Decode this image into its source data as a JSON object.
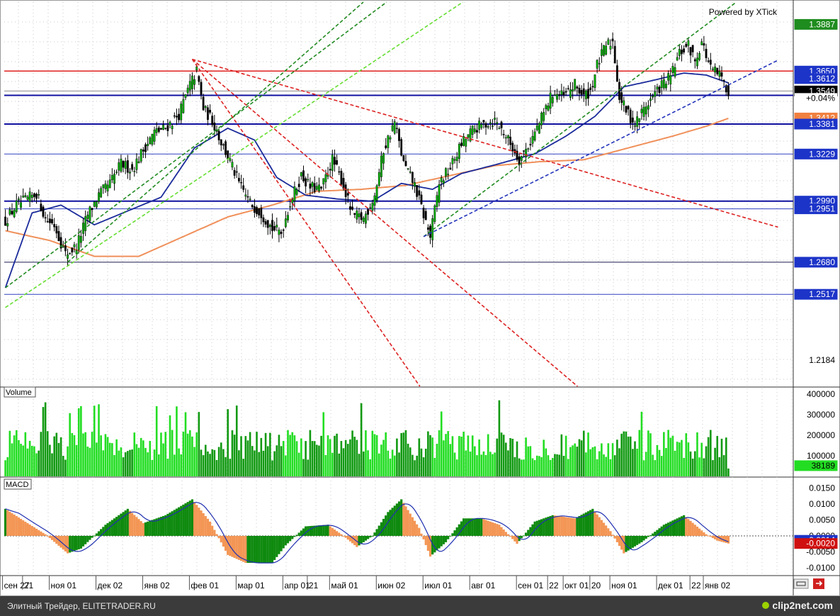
{
  "powered_by": "Powered by XTick",
  "footer": {
    "caption": "Элитный Трейдер, ELITETRADER.RU",
    "brand": "clip2net.com"
  },
  "price_pane": {
    "y_range": [
      1.205,
      1.4
    ],
    "price_labels": [
      {
        "text": "1.3887",
        "value": 1.3887,
        "bg": "#1e8c1e",
        "fg": "#ffffff"
      },
      {
        "text": "1.3650",
        "value": 1.365,
        "bg": "#1c34c8",
        "fg": "#ffffff"
      },
      {
        "text": "1.3612",
        "value": 1.3612,
        "bg": "#1c34c8",
        "fg": "#ffffff"
      },
      {
        "text": "1.3549",
        "value": 1.3549,
        "bg": "#000000",
        "fg": "#ffffff"
      },
      {
        "text": "+0.04%",
        "value": 1.3513,
        "bg": "#ffffff",
        "fg": "#000000"
      },
      {
        "text": "1.3412",
        "value": 1.3412,
        "bg": "#f08040",
        "fg": "#ffffff"
      },
      {
        "text": "1.3381",
        "value": 1.3381,
        "bg": "#1c34c8",
        "fg": "#ffffff"
      },
      {
        "text": "1.3229",
        "value": 1.3229,
        "bg": "#1c34c8",
        "fg": "#ffffff"
      },
      {
        "text": "1.2990",
        "value": 1.299,
        "bg": "#1c34c8",
        "fg": "#ffffff"
      },
      {
        "text": "1.2951",
        "value": 1.2951,
        "bg": "#1c34c8",
        "fg": "#ffffff"
      },
      {
        "text": "1.2680",
        "value": 1.268,
        "bg": "#1c34c8",
        "fg": "#ffffff"
      },
      {
        "text": "1.2517",
        "value": 1.2517,
        "bg": "#1c34c8",
        "fg": "#ffffff"
      },
      {
        "text": "1.2184",
        "value": 1.2184,
        "bg": "#ffffff",
        "fg": "#000000"
      }
    ],
    "horizontal_levels": [
      {
        "value": 1.365,
        "color": "#e02020",
        "width": 1.5
      },
      {
        "value": 1.3549,
        "color": "#888888",
        "width": 1
      },
      {
        "value": 1.3527,
        "color": "#1010a0",
        "width": 2
      },
      {
        "value": 1.3381,
        "color": "#1010a0",
        "width": 2
      },
      {
        "value": 1.3229,
        "color": "#3040c0",
        "width": 1
      },
      {
        "value": 1.299,
        "color": "#1010a0",
        "width": 2
      },
      {
        "value": 1.2951,
        "color": "#3040c0",
        "width": 1
      },
      {
        "value": 1.268,
        "color": "#1a1a50",
        "width": 1
      },
      {
        "value": 1.2517,
        "color": "#3040c0",
        "width": 1
      }
    ]
  },
  "volume_pane": {
    "label": "Volume",
    "y_range": [
      0,
      400000
    ],
    "ticks": [
      {
        "text": "400000",
        "value": 400000
      },
      {
        "text": "300000",
        "value": 300000
      },
      {
        "text": "200000",
        "value": 200000
      },
      {
        "text": "100000",
        "value": 100000
      }
    ],
    "last_label": {
      "text": "38189",
      "value": 38189,
      "bg": "#22dd22",
      "fg": "#000000"
    }
  },
  "macd_pane": {
    "label": "MACD",
    "y_range": [
      -0.0125,
      0.0185
    ],
    "ticks": [
      {
        "text": "0.0150",
        "value": 0.015
      },
      {
        "text": "0.0100",
        "value": 0.01
      },
      {
        "text": "0.0050",
        "value": 0.005
      },
      {
        "text": "0.0000",
        "value": 0.0
      },
      {
        "text": "-0.0050",
        "value": -0.005
      },
      {
        "text": "-0.0100",
        "value": -0.01
      }
    ],
    "last_labels": [
      {
        "text": "-0.0014",
        "value": -0.0014,
        "bg": "#1c34c8",
        "fg": "#ffffff"
      },
      {
        "text": "-0.0020",
        "value": -0.0024,
        "bg": "#d01010",
        "fg": "#ffffff"
      }
    ]
  },
  "x_axis": {
    "labels": [
      {
        "text": "сен 27",
        "bar": 0
      },
      {
        "text": "21",
        "bar": 9
      },
      {
        "text": "ноя 01",
        "bar": 21
      },
      {
        "text": "дек 02",
        "bar": 42
      },
      {
        "text": "янв 02",
        "bar": 63
      },
      {
        "text": "фев 01",
        "bar": 84
      },
      {
        "text": "мар 01",
        "bar": 105
      },
      {
        "text": "апр 01",
        "bar": 126
      },
      {
        "text": "21",
        "bar": 137
      },
      {
        "text": "май 01",
        "bar": 147
      },
      {
        "text": "июн 02",
        "bar": 168
      },
      {
        "text": "июл 01",
        "bar": 189
      },
      {
        "text": "авг 01",
        "bar": 210
      },
      {
        "text": "сен 01",
        "bar": 231
      },
      {
        "text": "22",
        "bar": 245
      },
      {
        "text": "окт 01",
        "bar": 252
      },
      {
        "text": "20",
        "bar": 264
      },
      {
        "text": "ноя 01",
        "bar": 273
      },
      {
        "text": "дек 01",
        "bar": 294
      },
      {
        "text": "22",
        "bar": 309
      },
      {
        "text": "янв 02",
        "bar": 315
      }
    ]
  },
  "chart_data": {
    "type": "candlestick",
    "series_count_bars": 326,
    "anchors": [
      {
        "bar": 0,
        "price": 1.289
      },
      {
        "bar": 5,
        "price": 1.297
      },
      {
        "bar": 10,
        "price": 1.3
      },
      {
        "bar": 14,
        "price": 1.303
      },
      {
        "bar": 18,
        "price": 1.29
      },
      {
        "bar": 22,
        "price": 1.287
      },
      {
        "bar": 27,
        "price": 1.272
      },
      {
        "bar": 32,
        "price": 1.276
      },
      {
        "bar": 37,
        "price": 1.292
      },
      {
        "bar": 42,
        "price": 1.302
      },
      {
        "bar": 47,
        "price": 1.308
      },
      {
        "bar": 52,
        "price": 1.318
      },
      {
        "bar": 57,
        "price": 1.315
      },
      {
        "bar": 62,
        "price": 1.325
      },
      {
        "bar": 67,
        "price": 1.334
      },
      {
        "bar": 72,
        "price": 1.336
      },
      {
        "bar": 78,
        "price": 1.343
      },
      {
        "bar": 83,
        "price": 1.358
      },
      {
        "bar": 86,
        "price": 1.365
      },
      {
        "bar": 89,
        "price": 1.346
      },
      {
        "bar": 93,
        "price": 1.34
      },
      {
        "bar": 97,
        "price": 1.329
      },
      {
        "bar": 101,
        "price": 1.319
      },
      {
        "bar": 105,
        "price": 1.308
      },
      {
        "bar": 110,
        "price": 1.298
      },
      {
        "bar": 115,
        "price": 1.293
      },
      {
        "bar": 120,
        "price": 1.285
      },
      {
        "bar": 124,
        "price": 1.283
      },
      {
        "bar": 128,
        "price": 1.298
      },
      {
        "bar": 133,
        "price": 1.312
      },
      {
        "bar": 137,
        "price": 1.306
      },
      {
        "bar": 142,
        "price": 1.305
      },
      {
        "bar": 147,
        "price": 1.32
      },
      {
        "bar": 151,
        "price": 1.31
      },
      {
        "bar": 156,
        "price": 1.292
      },
      {
        "bar": 161,
        "price": 1.29
      },
      {
        "bar": 166,
        "price": 1.302
      },
      {
        "bar": 170,
        "price": 1.325
      },
      {
        "bar": 175,
        "price": 1.339
      },
      {
        "bar": 179,
        "price": 1.318
      },
      {
        "bar": 184,
        "price": 1.307
      },
      {
        "bar": 188,
        "price": 1.292
      },
      {
        "bar": 191,
        "price": 1.281
      },
      {
        "bar": 195,
        "price": 1.308
      },
      {
        "bar": 200,
        "price": 1.316
      },
      {
        "bar": 205,
        "price": 1.328
      },
      {
        "bar": 210,
        "price": 1.335
      },
      {
        "bar": 215,
        "price": 1.338
      },
      {
        "bar": 220,
        "price": 1.34
      },
      {
        "bar": 224,
        "price": 1.334
      },
      {
        "bar": 228,
        "price": 1.326
      },
      {
        "bar": 231,
        "price": 1.32
      },
      {
        "bar": 236,
        "price": 1.329
      },
      {
        "bar": 241,
        "price": 1.341
      },
      {
        "bar": 246,
        "price": 1.354
      },
      {
        "bar": 251,
        "price": 1.352
      },
      {
        "bar": 256,
        "price": 1.358
      },
      {
        "bar": 260,
        "price": 1.352
      },
      {
        "bar": 263,
        "price": 1.355
      },
      {
        "bar": 266,
        "price": 1.368
      },
      {
        "bar": 270,
        "price": 1.378
      },
      {
        "bar": 273,
        "price": 1.38
      },
      {
        "bar": 276,
        "price": 1.352
      },
      {
        "bar": 279,
        "price": 1.345
      },
      {
        "bar": 283,
        "price": 1.338
      },
      {
        "bar": 287,
        "price": 1.346
      },
      {
        "bar": 291,
        "price": 1.352
      },
      {
        "bar": 295,
        "price": 1.358
      },
      {
        "bar": 299,
        "price": 1.362
      },
      {
        "bar": 303,
        "price": 1.374
      },
      {
        "bar": 307,
        "price": 1.378
      },
      {
        "bar": 310,
        "price": 1.37
      },
      {
        "bar": 313,
        "price": 1.38
      },
      {
        "bar": 317,
        "price": 1.366
      },
      {
        "bar": 321,
        "price": 1.363
      },
      {
        "bar": 325,
        "price": 1.3549
      }
    ],
    "sma_blue_anchors": [
      {
        "bar": 0,
        "price": 1.255
      },
      {
        "bar": 12,
        "price": 1.293
      },
      {
        "bar": 25,
        "price": 1.297
      },
      {
        "bar": 40,
        "price": 1.287
      },
      {
        "bar": 55,
        "price": 1.294
      },
      {
        "bar": 70,
        "price": 1.301
      },
      {
        "bar": 85,
        "price": 1.326
      },
      {
        "bar": 100,
        "price": 1.336
      },
      {
        "bar": 112,
        "price": 1.33
      },
      {
        "bar": 122,
        "price": 1.311
      },
      {
        "bar": 135,
        "price": 1.302
      },
      {
        "bar": 150,
        "price": 1.3
      },
      {
        "bar": 165,
        "price": 1.299
      },
      {
        "bar": 178,
        "price": 1.308
      },
      {
        "bar": 192,
        "price": 1.305
      },
      {
        "bar": 205,
        "price": 1.313
      },
      {
        "bar": 222,
        "price": 1.318
      },
      {
        "bar": 238,
        "price": 1.323
      },
      {
        "bar": 252,
        "price": 1.332
      },
      {
        "bar": 265,
        "price": 1.342
      },
      {
        "bar": 278,
        "price": 1.357
      },
      {
        "bar": 290,
        "price": 1.36
      },
      {
        "bar": 305,
        "price": 1.364
      },
      {
        "bar": 315,
        "price": 1.363
      },
      {
        "bar": 325,
        "price": 1.359
      }
    ],
    "sma_orange_anchors": [
      {
        "bar": 0,
        "price": 1.284
      },
      {
        "bar": 20,
        "price": 1.279
      },
      {
        "bar": 40,
        "price": 1.271
      },
      {
        "bar": 60,
        "price": 1.271
      },
      {
        "bar": 80,
        "price": 1.281
      },
      {
        "bar": 100,
        "price": 1.291
      },
      {
        "bar": 120,
        "price": 1.297
      },
      {
        "bar": 140,
        "price": 1.304
      },
      {
        "bar": 160,
        "price": 1.305
      },
      {
        "bar": 180,
        "price": 1.307
      },
      {
        "bar": 200,
        "price": 1.312
      },
      {
        "bar": 220,
        "price": 1.317
      },
      {
        "bar": 240,
        "price": 1.319
      },
      {
        "bar": 260,
        "price": 1.32
      },
      {
        "bar": 280,
        "price": 1.326
      },
      {
        "bar": 300,
        "price": 1.332
      },
      {
        "bar": 315,
        "price": 1.337
      },
      {
        "bar": 325,
        "price": 1.341
      }
    ],
    "trendlines": [
      {
        "color": "#228b22",
        "p1": {
          "bar": 0,
          "price": 1.255
        },
        "p2": {
          "bar": 325,
          "price": 1.53
        }
      },
      {
        "color": "#228b22",
        "p1": {
          "bar": 28,
          "price": 1.268
        },
        "p2": {
          "bar": 325,
          "price": 1.563
        }
      },
      {
        "color": "#66dd33",
        "p1": {
          "bar": 0,
          "price": 1.245
        },
        "p2": {
          "bar": 325,
          "price": 1.49
        }
      },
      {
        "color": "#228b22",
        "p1": {
          "bar": 188,
          "price": 1.281
        },
        "p2": {
          "bar": 325,
          "price": 1.397
        }
      },
      {
        "color": "#2233bb",
        "p1": {
          "bar": 188,
          "price": 1.281
        },
        "p2": {
          "bar": 325,
          "price": 1.358
        }
      },
      {
        "color": "#dd2222",
        "p1": {
          "bar": 84,
          "price": 1.371
        },
        "p2": {
          "bar": 325,
          "price": 1.293
        }
      },
      {
        "color": "#dd2222",
        "p1": {
          "bar": 84,
          "price": 1.371
        },
        "p2": {
          "bar": 325,
          "price": 0.98
        }
      },
      {
        "color": "#dd2222",
        "p1": {
          "bar": 84,
          "price": 1.371
        },
        "p2": {
          "bar": 325,
          "price": 1.14
        }
      }
    ],
    "volume": {
      "base": 130000,
      "min": 60000,
      "max": 370000,
      "last": 38189
    },
    "macd": {
      "anchors": [
        {
          "bar": 0,
          "value": 0.0085
        },
        {
          "bar": 10,
          "value": 0.004
        },
        {
          "bar": 18,
          "value": 0.0005
        },
        {
          "bar": 28,
          "value": -0.0055
        },
        {
          "bar": 34,
          "value": -0.004
        },
        {
          "bar": 45,
          "value": 0.0035
        },
        {
          "bar": 55,
          "value": 0.0085
        },
        {
          "bar": 62,
          "value": 0.004
        },
        {
          "bar": 72,
          "value": 0.0065
        },
        {
          "bar": 84,
          "value": 0.0115
        },
        {
          "bar": 92,
          "value": 0.0045
        },
        {
          "bar": 100,
          "value": -0.006
        },
        {
          "bar": 108,
          "value": -0.0085
        },
        {
          "bar": 120,
          "value": -0.0085
        },
        {
          "bar": 126,
          "value": -0.003
        },
        {
          "bar": 135,
          "value": 0.003
        },
        {
          "bar": 145,
          "value": 0.0035
        },
        {
          "bar": 152,
          "value": 0.0
        },
        {
          "bar": 158,
          "value": -0.0035
        },
        {
          "bar": 165,
          "value": 0.0
        },
        {
          "bar": 172,
          "value": 0.0075
        },
        {
          "bar": 178,
          "value": 0.0115
        },
        {
          "bar": 186,
          "value": 0.0025
        },
        {
          "bar": 191,
          "value": -0.0065
        },
        {
          "bar": 198,
          "value": -0.002
        },
        {
          "bar": 206,
          "value": 0.0055
        },
        {
          "bar": 214,
          "value": 0.0055
        },
        {
          "bar": 222,
          "value": 0.0035
        },
        {
          "bar": 230,
          "value": -0.0025
        },
        {
          "bar": 238,
          "value": 0.0045
        },
        {
          "bar": 246,
          "value": 0.0065
        },
        {
          "bar": 256,
          "value": 0.0055
        },
        {
          "bar": 264,
          "value": 0.0085
        },
        {
          "bar": 272,
          "value": 0.0015
        },
        {
          "bar": 278,
          "value": -0.0055
        },
        {
          "bar": 286,
          "value": -0.002
        },
        {
          "bar": 296,
          "value": 0.0035
        },
        {
          "bar": 305,
          "value": 0.0065
        },
        {
          "bar": 315,
          "value": 0.0005
        },
        {
          "bar": 320,
          "value": -0.0015
        },
        {
          "bar": 325,
          "value": -0.0024
        }
      ],
      "signal_lag": 6
    }
  }
}
